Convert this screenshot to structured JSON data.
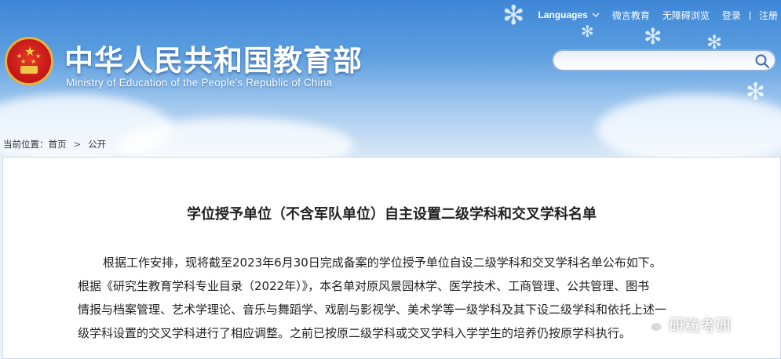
{
  "header": {
    "top_links": {
      "languages": "Languages",
      "weibo": "微言教育",
      "accessibility": "无障碍浏览",
      "login": "登录",
      "separator": "|",
      "register": "注册"
    },
    "logo_cn": "中华人民共和国教育部",
    "logo_en": "Ministry of Education of the People's Republic of China",
    "search": {
      "placeholder": ""
    }
  },
  "breadcrumb": {
    "prefix": "当前位置：",
    "items": [
      "首页",
      "公开"
    ],
    "separator": ">"
  },
  "article": {
    "title": "学位授予单位（不含军队单位）自主设置二级学科和交叉学科名单",
    "paragraph1": "根据工作安排，现将截至2023年6月30日完成备案的学位授予单位自设二级学科和交叉学科名单公布如下。",
    "paragraph2_lines": [
      "根据《研究生教育学科专业目录（2022年）》，本名单对原风景园林学、医学技术、工商管理、公共管理、图书",
      "情报与档案管理、艺术学理论、音乐与舞蹈学、戏剧与影视学、美术学等一级学科及其下设二级学科和依托上述一",
      "级学科设置的交叉学科进行了相应调整。之前已按原二级学科或交叉学科入学学生的培养仍按原学科执行。"
    ]
  },
  "watermark": {
    "text": "研粒考研",
    "icon": "wechat-icon"
  },
  "colors": {
    "header_blue": "#3e86d6",
    "emblem_red": "#c8191b",
    "emblem_gold": "#e7b43e"
  }
}
